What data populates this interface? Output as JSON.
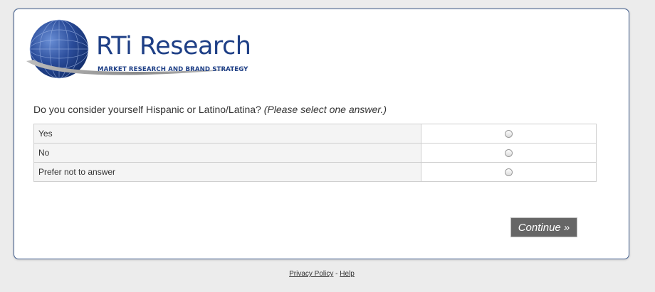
{
  "logo": {
    "brand": "RTi Research",
    "tagline": "MARKET RESEARCH AND BRAND STRATEGY",
    "icon": "globe-icon",
    "colors": {
      "brand_blue": "#1e3f86",
      "globe_dark": "#1a3578",
      "globe_light": "#6a8fd6"
    }
  },
  "question": {
    "text": "Do you consider yourself Hispanic or Latino/Latina?",
    "note": "(Please select one answer.)"
  },
  "answers": [
    {
      "label": "Yes",
      "selected": false
    },
    {
      "label": "No",
      "selected": false
    },
    {
      "label": "Prefer not to answer",
      "selected": false
    }
  ],
  "continue_label": "Continue »",
  "footer": {
    "privacy": "Privacy Policy",
    "separator": "-",
    "help": "Help"
  }
}
